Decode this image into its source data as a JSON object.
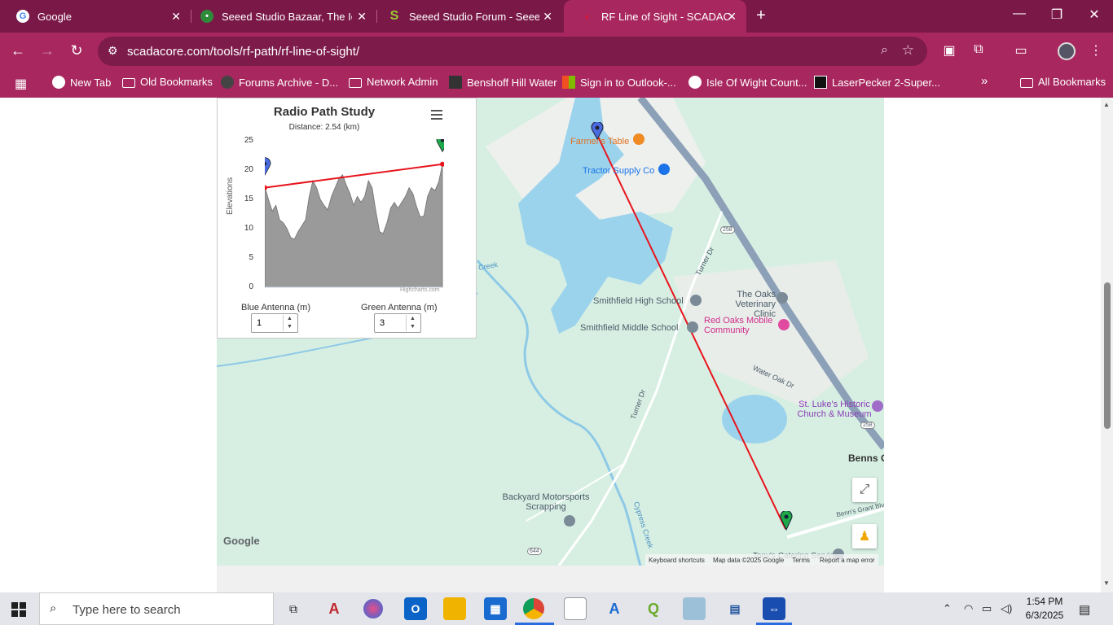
{
  "browser": {
    "tabs": [
      {
        "title": "Google",
        "favicon": "google-icon",
        "active": false
      },
      {
        "title": "Seeed Studio Bazaar, The IoT",
        "favicon": "seeed-bazaar-icon",
        "active": false
      },
      {
        "title": "Seeed Studio Forum - Seeed",
        "favicon": "seeed-forum-icon",
        "active": false
      },
      {
        "title": "RF Line of Sight - SCADACore",
        "favicon": "scadacore-icon",
        "active": true
      }
    ],
    "url": "scadacore.com/tools/rf-path/rf-line-of-sight/",
    "bookmarks": [
      {
        "label": "New Tab",
        "icon": "chrome-icon"
      },
      {
        "label": "Old Bookmarks",
        "icon": "folder-icon"
      },
      {
        "label": "Forums Archive - D...",
        "icon": "forum-icon"
      },
      {
        "label": "Network Admin",
        "icon": "folder-icon"
      },
      {
        "label": "Benshoff Hill Water",
        "icon": "cube-icon"
      },
      {
        "label": "Sign in to Outlook-...",
        "icon": "microsoft-icon"
      },
      {
        "label": "Isle Of Wight Count...",
        "icon": "globe-icon"
      },
      {
        "label": "LaserPecker 2-Super...",
        "icon": "laserpecker-icon"
      }
    ],
    "all_bookmarks_label": "All Bookmarks",
    "colors": {
      "frame": "#7a1848",
      "toolbar": "#a8275f",
      "omnibox": "#7d1b4b"
    }
  },
  "study": {
    "title": "Radio Path Study",
    "subtitle": "Distance: 2.54 (km)",
    "y_axis_label": "Elevations",
    "credit": "Highcharts.com",
    "blue_antenna_label": "Blue Antenna (m)",
    "blue_antenna_value": "1",
    "green_antenna_label": "Green Antenna (m)",
    "green_antenna_value": "3"
  },
  "chart_data": {
    "type": "area",
    "title": "Radio Path Study",
    "subtitle": "Distance: 2.54 (km)",
    "ylabel": "Elevations",
    "ylim": [
      0,
      25
    ],
    "yticks": [
      0,
      5,
      10,
      15,
      20,
      25
    ],
    "profile": [
      17.2,
      15,
      13,
      14,
      11.5,
      11,
      10,
      8.5,
      8.2,
      9.5,
      10.5,
      11.5,
      15.5,
      18.2,
      17,
      15,
      14,
      13.2,
      15.5,
      17,
      18.5,
      19.2,
      17.5,
      16,
      14,
      15.5,
      14.5,
      15.5,
      18.2,
      17,
      13,
      9.5,
      9.2,
      11,
      13.5,
      14.5,
      13.5,
      14.5,
      15.5,
      17,
      16,
      13.8,
      12,
      12.2,
      15.5,
      17,
      16.5,
      18,
      21
    ],
    "line_of_sight": {
      "start": 17,
      "end": 21
    },
    "colors": {
      "terrain": "#9a9a9a",
      "los": "#e8141c",
      "blue_marker": "#4a6be0",
      "green_marker": "#1fa84a"
    }
  },
  "map": {
    "labels": {
      "farmers_table": "Farmer's Table",
      "tractor_supply": "Tractor Supply Co",
      "smithfield_high": "Smithfield High School",
      "smithfield_middle": "Smithfield Middle School",
      "oaks_vet": "The Oaks Veterinary Clinic",
      "red_oaks": "Red Oaks Mobile Community",
      "st_lukes": "St. Luke's Historic Church & Museum",
      "benns": "Benns C",
      "backyard": "Backyard Motorsports Scrapping",
      "turner_dr_1": "Turner Dr",
      "turner_dr_2": "Turner Dr",
      "water_oak": "Water Oak Dr",
      "cypress_creek": "Cypress Creek",
      "creek": "Creek",
      "benns_grant": "Benn's Grant Blv",
      "tonys": "Tony's Catering Services",
      "shield_258a": "258",
      "shield_258b": "258",
      "shield_644": "644"
    },
    "google_logo": "Google",
    "attribution": {
      "shortcuts": "Keyboard shortcuts",
      "data": "Map data ©2025 Google",
      "terms": "Terms",
      "report": "Report a map error"
    }
  },
  "taskbar": {
    "search_placeholder": "Type here to search",
    "time": "1:54 PM",
    "date": "6/3/2025"
  }
}
